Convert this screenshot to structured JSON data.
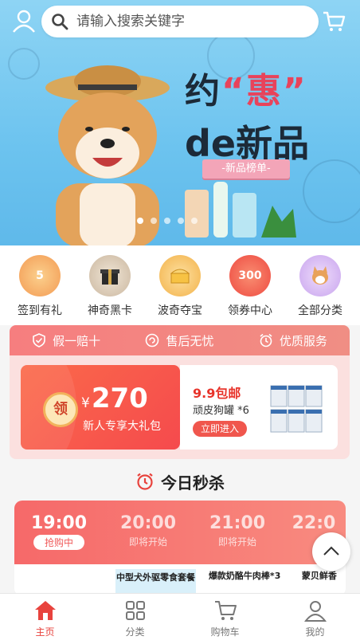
{
  "search": {
    "placeholder": "请输入搜索关键字"
  },
  "banner": {
    "title_prefix": "约",
    "title_highlight": "“惠”",
    "subtitle": "de新品",
    "ribbon": "-新品榜单-",
    "dots": 5,
    "active_dot": 0
  },
  "categories": [
    {
      "label": "签到有礼",
      "icon": "sign-in-gift-icon",
      "color": "#f7a65a",
      "badge": "5"
    },
    {
      "label": "神奇黑卡",
      "icon": "black-card-icon",
      "color": "#5a4638",
      "badge": ""
    },
    {
      "label": "波奇夺宝",
      "icon": "treasure-icon",
      "color": "#f5b544",
      "badge": ""
    },
    {
      "label": "领券中心",
      "icon": "coupon-center-icon",
      "color": "#f0564d",
      "badge": "300"
    },
    {
      "label": "全部分类",
      "icon": "all-categories-icon",
      "color": "#d9b9f0",
      "badge": ""
    }
  ],
  "guarantees": [
    {
      "label": "假一赔十",
      "icon": "shield-check-icon"
    },
    {
      "label": "售后无忧",
      "icon": "after-sales-icon"
    },
    {
      "label": "优质服务",
      "icon": "alarm-service-icon"
    }
  ],
  "newcomer": {
    "badge": "领",
    "currency": "¥",
    "amount": "270",
    "desc": "新人专享大礼包"
  },
  "pack_deal": {
    "title": "9.9包邮",
    "item": "顽皮狗罐 *6",
    "button": "立即进入"
  },
  "seckill": {
    "title": "今日秒杀",
    "slots": [
      {
        "time": "19:00",
        "status": "抢购中",
        "active": true
      },
      {
        "time": "20:00",
        "status": "即将开始",
        "active": false
      },
      {
        "time": "21:00",
        "status": "即将开始",
        "active": false
      },
      {
        "time": "22:0",
        "status": "",
        "active": false
      }
    ],
    "items": [
      "",
      "中型犬外驱零食套餐",
      "爆款奶酪牛肉棒*3",
      "蒙贝鲜香"
    ]
  },
  "nav": [
    {
      "label": "主页",
      "icon": "home-icon",
      "active": true
    },
    {
      "label": "分类",
      "icon": "grid-icon",
      "active": false
    },
    {
      "label": "购物车",
      "icon": "cart-icon",
      "active": false
    },
    {
      "label": "我的",
      "icon": "profile-icon",
      "active": false
    }
  ],
  "colors": {
    "accent": "#e8433d",
    "banner_bg": "#6cc3ef"
  }
}
